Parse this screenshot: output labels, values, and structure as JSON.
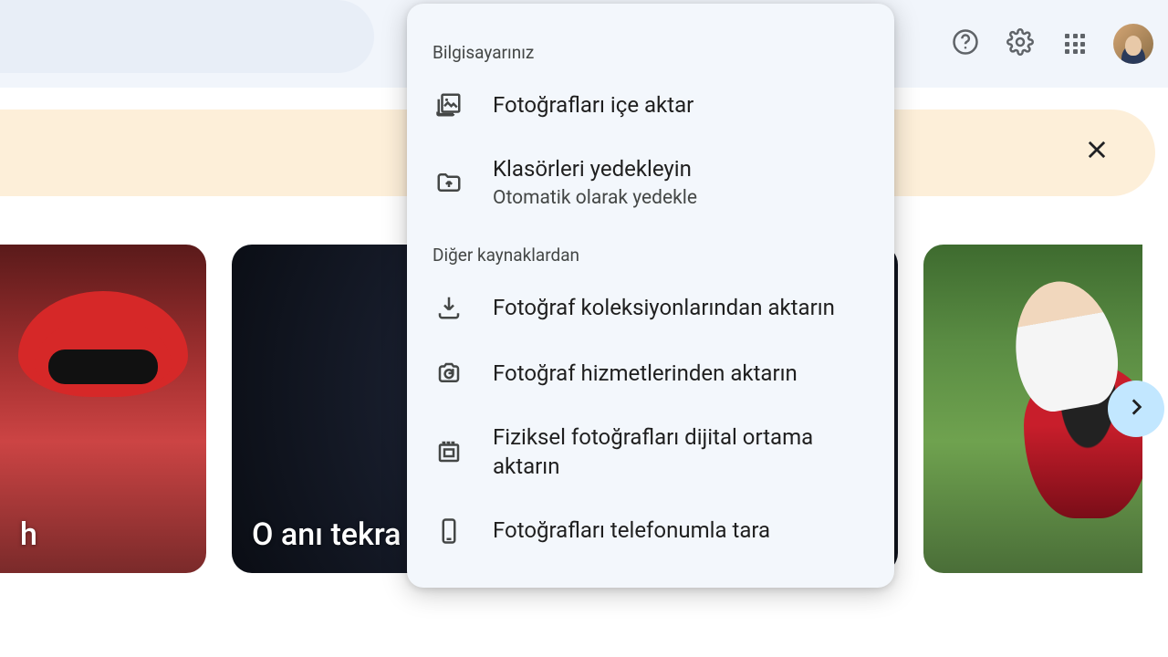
{
  "header": {
    "help_label": "Yardım",
    "settings_label": "Ayarlar",
    "apps_label": "Google uygulamaları",
    "account_label": "Google Hesabı"
  },
  "banner": {
    "close_label": "Kapat"
  },
  "carousel": {
    "card1_caption": "h",
    "card2_caption": "O anı tekra",
    "card3_caption": "",
    "next_label": "İleri"
  },
  "dropdown": {
    "section1_label": "Bilgisayarınız",
    "import_photos_label": "Fotoğrafları içe aktar",
    "backup_folders_label": "Klasörleri yedekleyin",
    "backup_folders_sub": "Otomatik olarak yedekle",
    "section2_label": "Diğer kaynaklardan",
    "from_collections_label": "Fotoğraf koleksiyonlarından aktarın",
    "from_services_label": "Fotoğraf hizmetlerinden aktarın",
    "digitize_label": "Fiziksel fotoğrafları dijital ortama aktarın",
    "scan_phone_label": "Fotoğrafları telefonumla tara"
  }
}
